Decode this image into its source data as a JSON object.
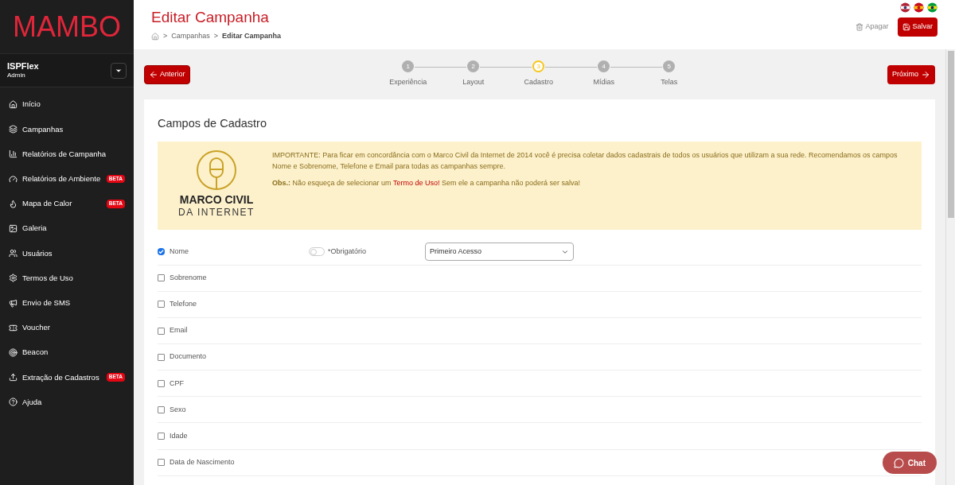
{
  "logo": "MAMBO",
  "account": {
    "name": "ISPFlex",
    "role": "Admin"
  },
  "sidebar": {
    "items": [
      {
        "label": "Início"
      },
      {
        "label": "Campanhas"
      },
      {
        "label": "Relatórios de Campanha"
      },
      {
        "label": "Relatórios de Ambiente",
        "badge": "BETA"
      },
      {
        "label": "Mapa de Calor",
        "badge": "BETA"
      },
      {
        "label": "Galeria"
      },
      {
        "label": "Usuários"
      },
      {
        "label": "Termos de Uso"
      },
      {
        "label": "Envio de SMS"
      },
      {
        "label": "Voucher"
      },
      {
        "label": "Beacon"
      },
      {
        "label": "Extração de Cadastros",
        "badge": "BETA"
      },
      {
        "label": "Ajuda"
      }
    ]
  },
  "header": {
    "title": "Editar Campanha",
    "breadcrumb": [
      {
        "separator": ">",
        "label": "Campanhas"
      },
      {
        "separator": ">",
        "label": "Editar Campanha"
      }
    ],
    "delete": "Apagar",
    "save": "Salvar"
  },
  "wizard": {
    "previous": "Anterior",
    "next": "Próximo",
    "steps": [
      {
        "number": "1",
        "label": "Experiência",
        "selected": false
      },
      {
        "number": "2",
        "label": "Layout",
        "selected": false
      },
      {
        "number": "3",
        "label": "Cadastro",
        "selected": true
      },
      {
        "number": "4",
        "label": "Mídias",
        "selected": false
      },
      {
        "number": "5",
        "label": "Telas",
        "selected": false
      }
    ]
  },
  "section": {
    "title": "Campos de Cadastro",
    "notice": {
      "logo_line_1": "MARCO CIVIL",
      "logo_line_2": "DA INTERNET",
      "text": "IMPORTANTE: Para ficar em concordância com o Marco Civil da Internet de 2014 você é precisa coletar dados cadastrais de todos os usuários que utilizam a sua rede. Recomendamos os campos Nome e Sobrenome, Telefone e Email para todas as campanhas sempre.",
      "obs_label": "Obs.:",
      "obs_before": "Não esqueça de selecionar um",
      "obs_link": "Termo de Uso!",
      "obs_after": "Sem ele a campanha não poderá ser salva!"
    },
    "fields": [
      {
        "label": "Nome",
        "checked": true,
        "required": {
          "label": "*Obrigatório",
          "on": false
        },
        "select": "Primeiro Acesso"
      },
      {
        "label": "Sobrenome",
        "checked": false
      },
      {
        "label": "Telefone",
        "checked": false
      },
      {
        "label": "Email",
        "checked": false
      },
      {
        "label": "Documento",
        "checked": false
      },
      {
        "label": "CPF",
        "checked": false
      },
      {
        "label": "Sexo",
        "checked": false
      },
      {
        "label": "Idade",
        "checked": false
      },
      {
        "label": "Data de Nascimento",
        "checked": false
      }
    ]
  },
  "chat": "Chat"
}
